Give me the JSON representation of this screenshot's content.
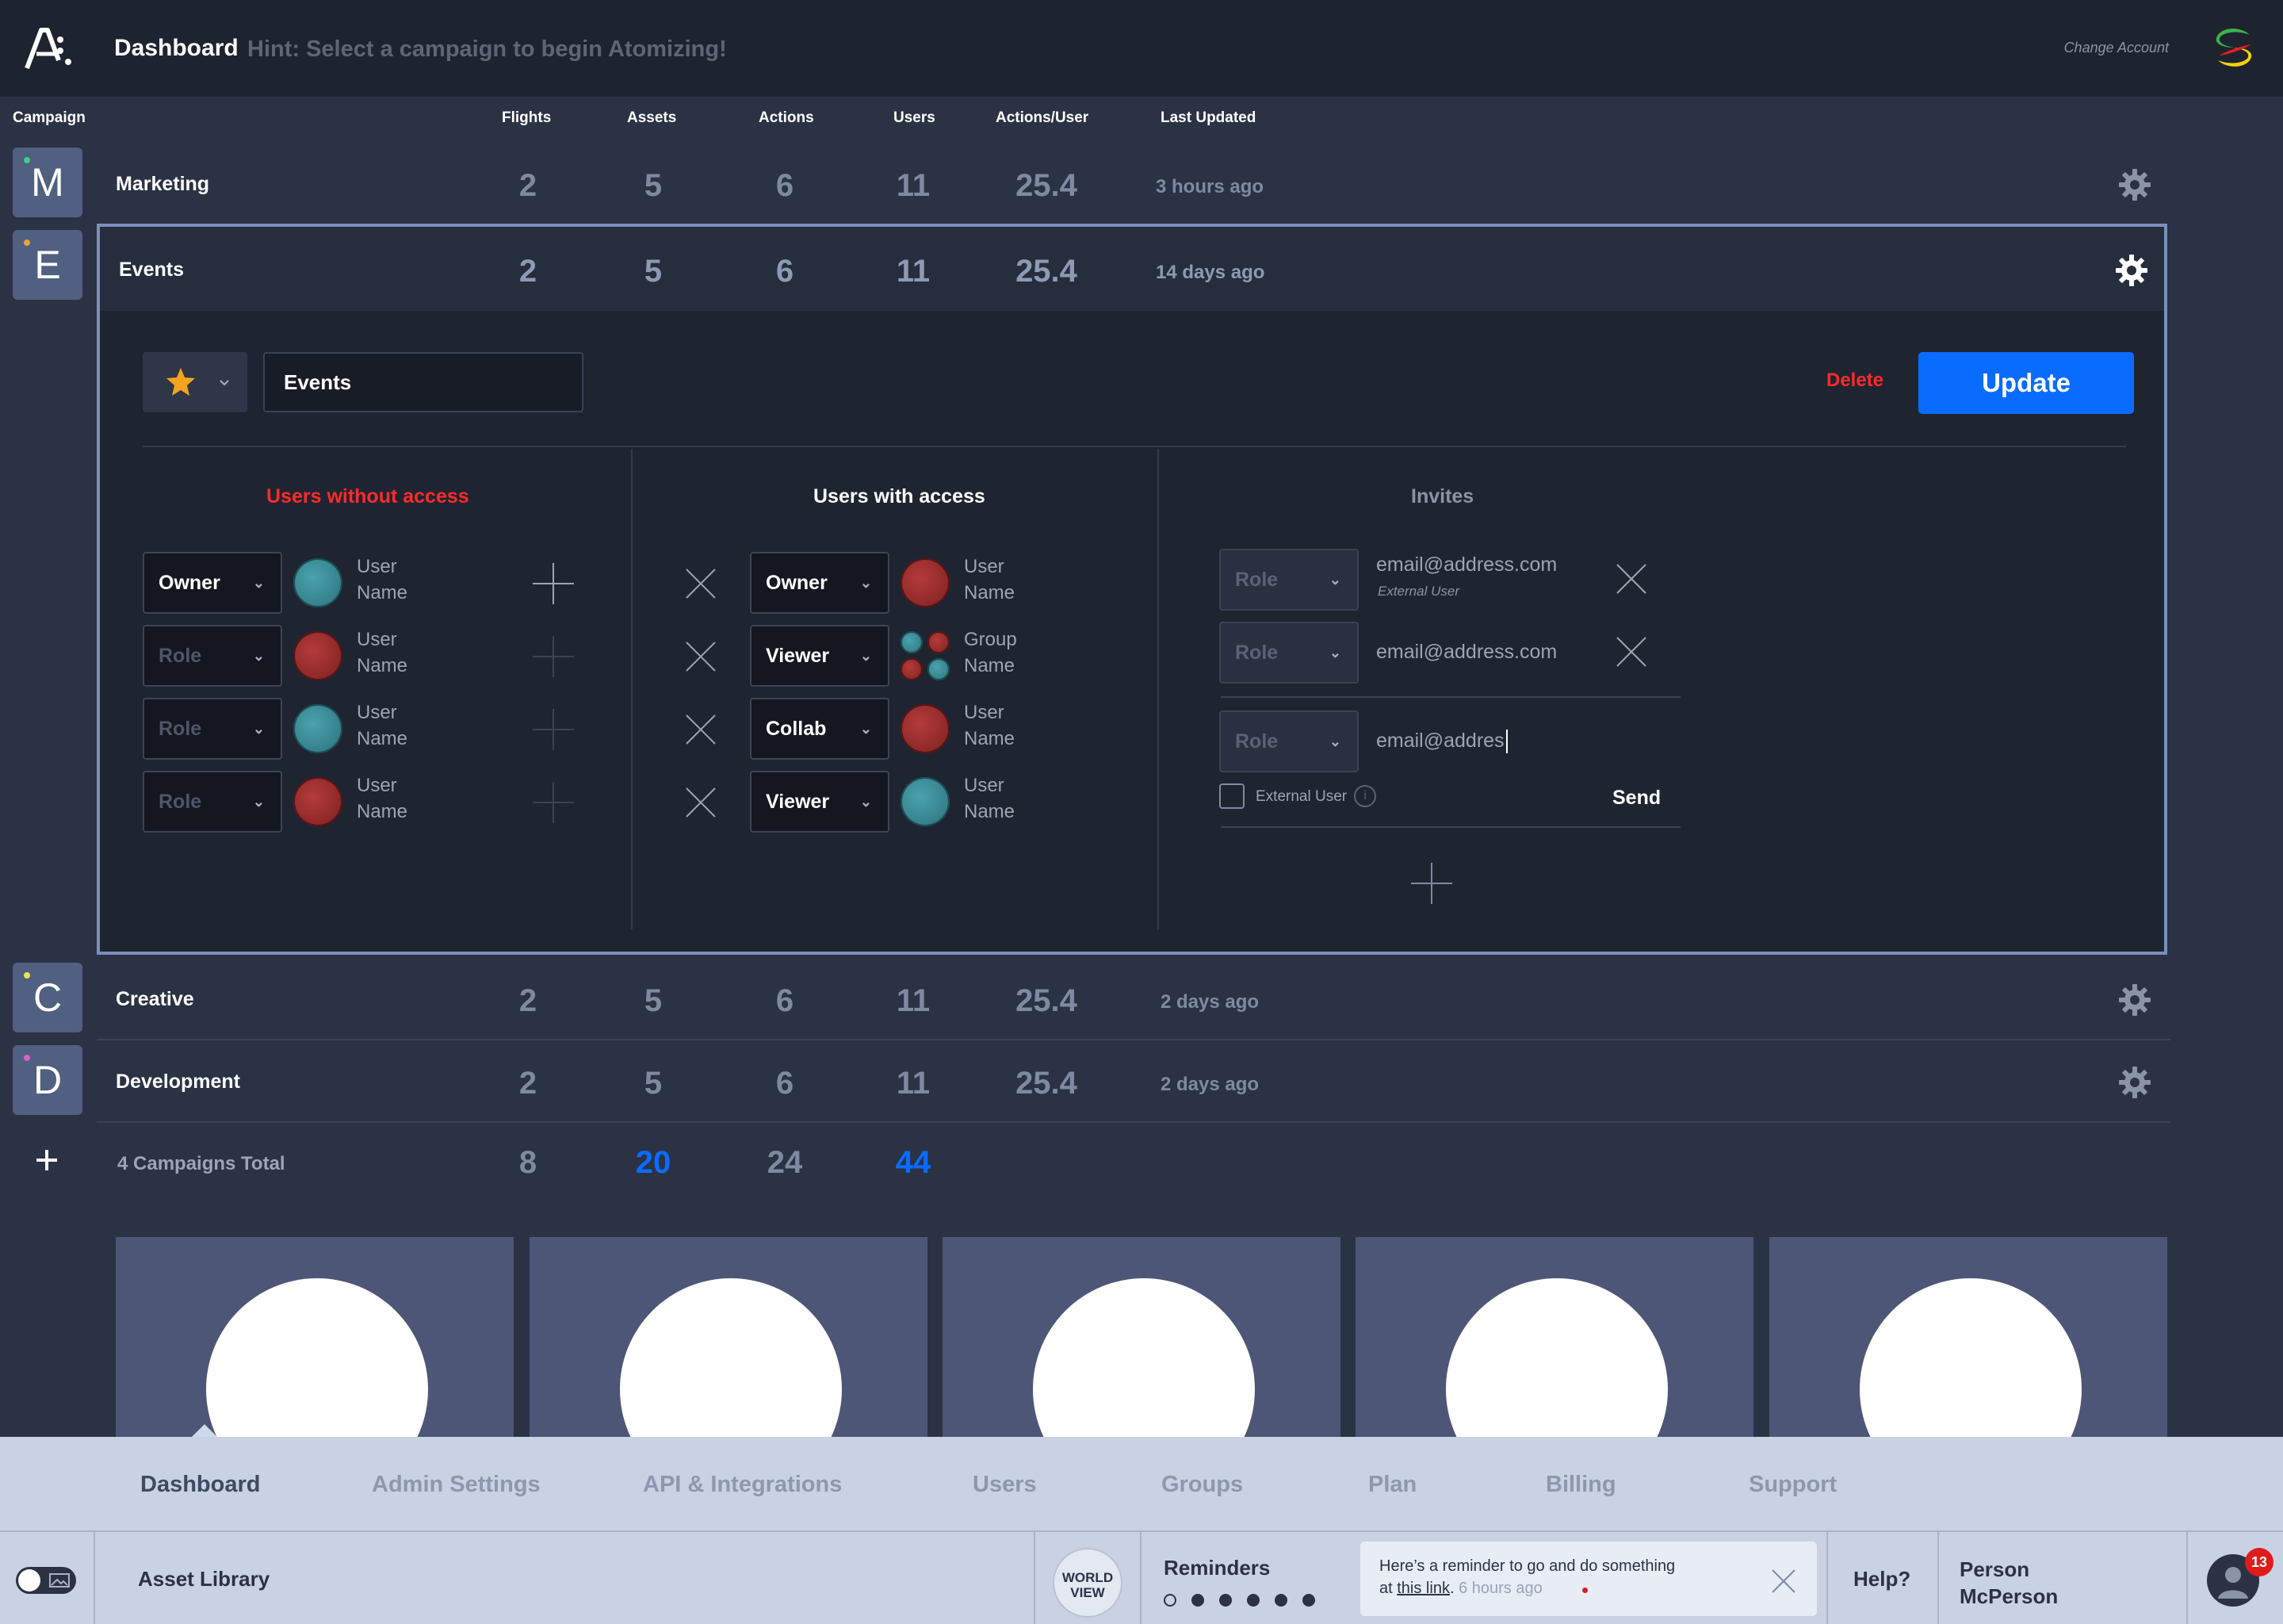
{
  "topbar": {
    "title": "Dashboard",
    "hint": "Hint: Select a campaign to begin Atomizing!",
    "change_account": "Change Account"
  },
  "columns": {
    "campaign": "Campaign",
    "flights": "Flights",
    "assets": "Assets",
    "actions": "Actions",
    "users": "Users",
    "actions_per_user": "Actions/User",
    "last_updated": "Last Updated"
  },
  "rail": [
    {
      "letter": "M",
      "dot_color": "#3ccf7a"
    },
    {
      "letter": "E",
      "dot_color": "#e8a33c"
    },
    {
      "letter": "C",
      "dot_color": "#f2e04a"
    },
    {
      "letter": "D",
      "dot_color": "#e05cc8"
    }
  ],
  "campaigns": [
    {
      "name": "Marketing",
      "flights": "2",
      "assets": "5",
      "actions": "6",
      "users": "11",
      "actions_per_user": "25.4",
      "updated": "3 hours ago"
    },
    {
      "name": "Events",
      "flights": "2",
      "assets": "5",
      "actions": "6",
      "users": "11",
      "actions_per_user": "25.4",
      "updated": "14 days ago"
    },
    {
      "name": "Creative",
      "flights": "2",
      "assets": "5",
      "actions": "6",
      "users": "11",
      "actions_per_user": "25.4",
      "updated": "2 days ago"
    },
    {
      "name": "Development",
      "flights": "2",
      "assets": "5",
      "actions": "6",
      "users": "11",
      "actions_per_user": "25.4",
      "updated": "2 days ago"
    }
  ],
  "editor": {
    "name_value": "Events",
    "delete_label": "Delete",
    "update_label": "Update",
    "without_access_title": "Users without access",
    "with_access_title": "Users with access",
    "invites_title": "Invites",
    "without_access": [
      {
        "role": "Owner",
        "name_line1": "User",
        "name_line2": "Name",
        "avatar": "teal"
      },
      {
        "role": "Role",
        "name_line1": "User",
        "name_line2": "Name",
        "avatar": "red"
      },
      {
        "role": "Role",
        "name_line1": "User",
        "name_line2": "Name",
        "avatar": "teal"
      },
      {
        "role": "Role",
        "name_line1": "User",
        "name_line2": "Name",
        "avatar": "red"
      }
    ],
    "with_access": [
      {
        "role": "Owner",
        "name_line1": "User",
        "name_line2": "Name",
        "avatar": "red"
      },
      {
        "role": "Viewer",
        "name_line1": "Group",
        "name_line2": "Name",
        "avatar": "group"
      },
      {
        "role": "Collab",
        "name_line1": "User",
        "name_line2": "Name",
        "avatar": "red"
      },
      {
        "role": "Viewer",
        "name_line1": "User",
        "name_line2": "Name",
        "avatar": "teal"
      }
    ],
    "invites": [
      {
        "role": "Role",
        "email": "email@address.com",
        "sub": "External User"
      },
      {
        "role": "Role",
        "email": "email@address.com",
        "sub": ""
      }
    ],
    "new_invite": {
      "role": "Role",
      "email": "email@addres",
      "external_label": "External User",
      "info": "i",
      "send_label": "Send"
    }
  },
  "totals": {
    "label": "4 Campaigns Total",
    "flights": "8",
    "assets": "20",
    "actions": "24",
    "users": "44"
  },
  "bottom_nav": {
    "items": [
      "Dashboard",
      "Admin Settings",
      "API & Integrations",
      "Users",
      "Groups",
      "Plan",
      "Billing",
      "Support"
    ],
    "active": "Dashboard"
  },
  "status_bar": {
    "asset_library": "Asset Library",
    "world_view_line1": "WORLD",
    "world_view_line2": "VIEW",
    "reminders_label": "Reminders",
    "reminder_text": "Here’s a reminder to go and do something",
    "reminder_prefix": "at ",
    "reminder_link": "this link",
    "reminder_suffix": ".",
    "reminder_time": "6 hours ago",
    "help_label": "Help?",
    "user_first": "Person",
    "user_last": "McPerson",
    "notification_count": "13"
  },
  "colors": {
    "accent_blue": "#0a6cff",
    "danger_red": "#ff2a2a",
    "background": "#2b3244"
  }
}
